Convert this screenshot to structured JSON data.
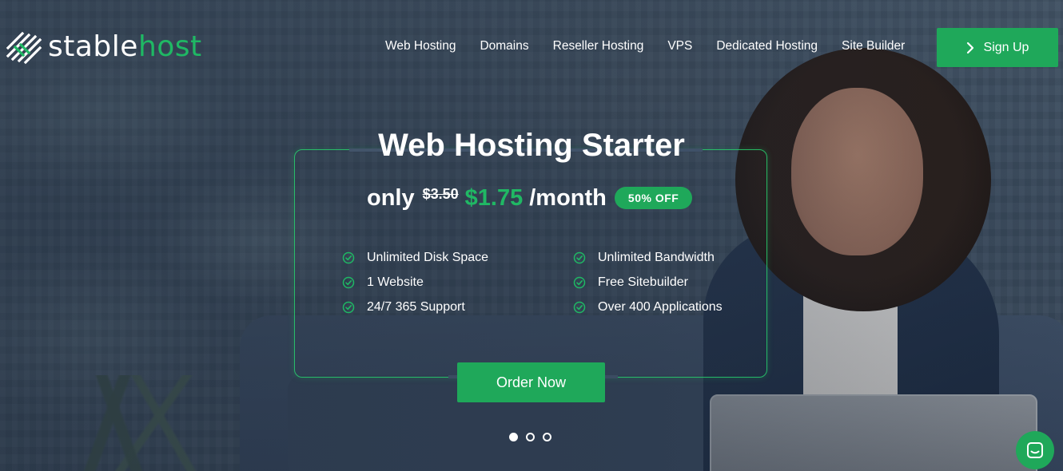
{
  "brand": {
    "name_part1": "stable",
    "name_part2": "host",
    "accent_color": "#1fa85a"
  },
  "nav": {
    "items": [
      {
        "label": "Web Hosting"
      },
      {
        "label": "Domains"
      },
      {
        "label": "Reseller Hosting"
      },
      {
        "label": "VPS"
      },
      {
        "label": "Dedicated Hosting"
      },
      {
        "label": "Site Builder"
      }
    ],
    "signup_label": "Sign Up",
    "signup_icon": "chevron-right-icon"
  },
  "promo": {
    "title": "Web Hosting Starter",
    "price_prefix": "only",
    "old_price": "$3.50",
    "new_price": "$1.75",
    "period": "/month",
    "badge": "50% OFF",
    "features_left": [
      {
        "label": "Unlimited Disk Space"
      },
      {
        "label": "1 Website"
      },
      {
        "label": "24/7 365 Support"
      }
    ],
    "features_right": [
      {
        "label": "Unlimited Bandwidth"
      },
      {
        "label": "Free Sitebuilder"
      },
      {
        "label": "Over 400 Applications"
      }
    ],
    "feature_icon": "check-circle-icon",
    "cta_label": "Order Now"
  },
  "carousel": {
    "slide_count": 3,
    "active_index": 0
  },
  "chat": {
    "icon": "chat-icon"
  }
}
